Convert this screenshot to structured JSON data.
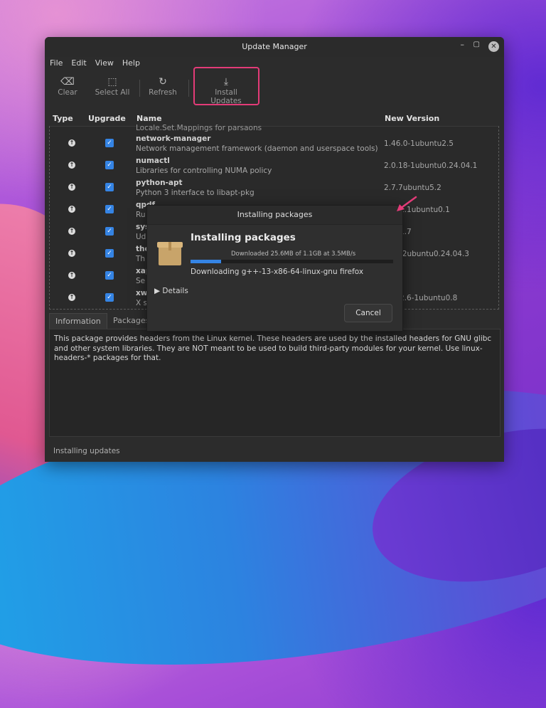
{
  "window": {
    "title": "Update Manager"
  },
  "menu": [
    "File",
    "Edit",
    "View",
    "Help"
  ],
  "toolbar": {
    "clear": "Clear",
    "select_all": "Select All",
    "refresh": "Refresh",
    "install": "Install Updates"
  },
  "columns": {
    "type": "Type",
    "upgrade": "Upgrade",
    "name": "Name",
    "new_version": "New Version"
  },
  "partial_row": "Locale.Set.Mappings for parsaons",
  "rows": [
    {
      "name": "network-manager",
      "desc": "Network management framework (daemon and userspace tools)",
      "version": "1.46.0-1ubuntu2.5"
    },
    {
      "name": "numactl",
      "desc": "Libraries for controlling NUMA policy",
      "version": "2.0.18-1ubuntu0.24.04.1"
    },
    {
      "name": "python-apt",
      "desc": "Python 3 interface to libapt-pkg",
      "version": "2.7.7ubuntu5.2"
    },
    {
      "name": "qpdf",
      "desc": "Ru",
      "version": "1.1ubuntu0.1"
    },
    {
      "name": "sys",
      "desc": "Ud",
      "version": "1.7"
    },
    {
      "name": "the",
      "desc": "Th",
      "version": "-2ubuntu0.24.04.3"
    },
    {
      "name": "xap",
      "desc": "Se",
      "version": ""
    },
    {
      "name": "xwa",
      "desc": "X s",
      "version": "2.6-1ubuntu0.8"
    }
  ],
  "tabs": {
    "info": "Information",
    "packages": "Packages"
  },
  "description": "This package provides headers from the Linux kernel.  These headers are used by the installed headers for GNU glibc and other system libraries. They are NOT meant to be used to build third-party modules for your kernel. Use linux-headers-* packages for that.",
  "status": "Installing updates",
  "dialog": {
    "title": "Installing packages",
    "heading": "Installing packages",
    "download_info": "Downloaded 25.6MB of 1.1GB at 3.5MB/s",
    "progress_fraction": 0.15,
    "downloading": "Downloading g++-13-x86-64-linux-gnu firefox",
    "details": "Details",
    "cancel": "Cancel"
  },
  "colors": {
    "accent": "#3584e4",
    "highlight": "#e33b78"
  }
}
